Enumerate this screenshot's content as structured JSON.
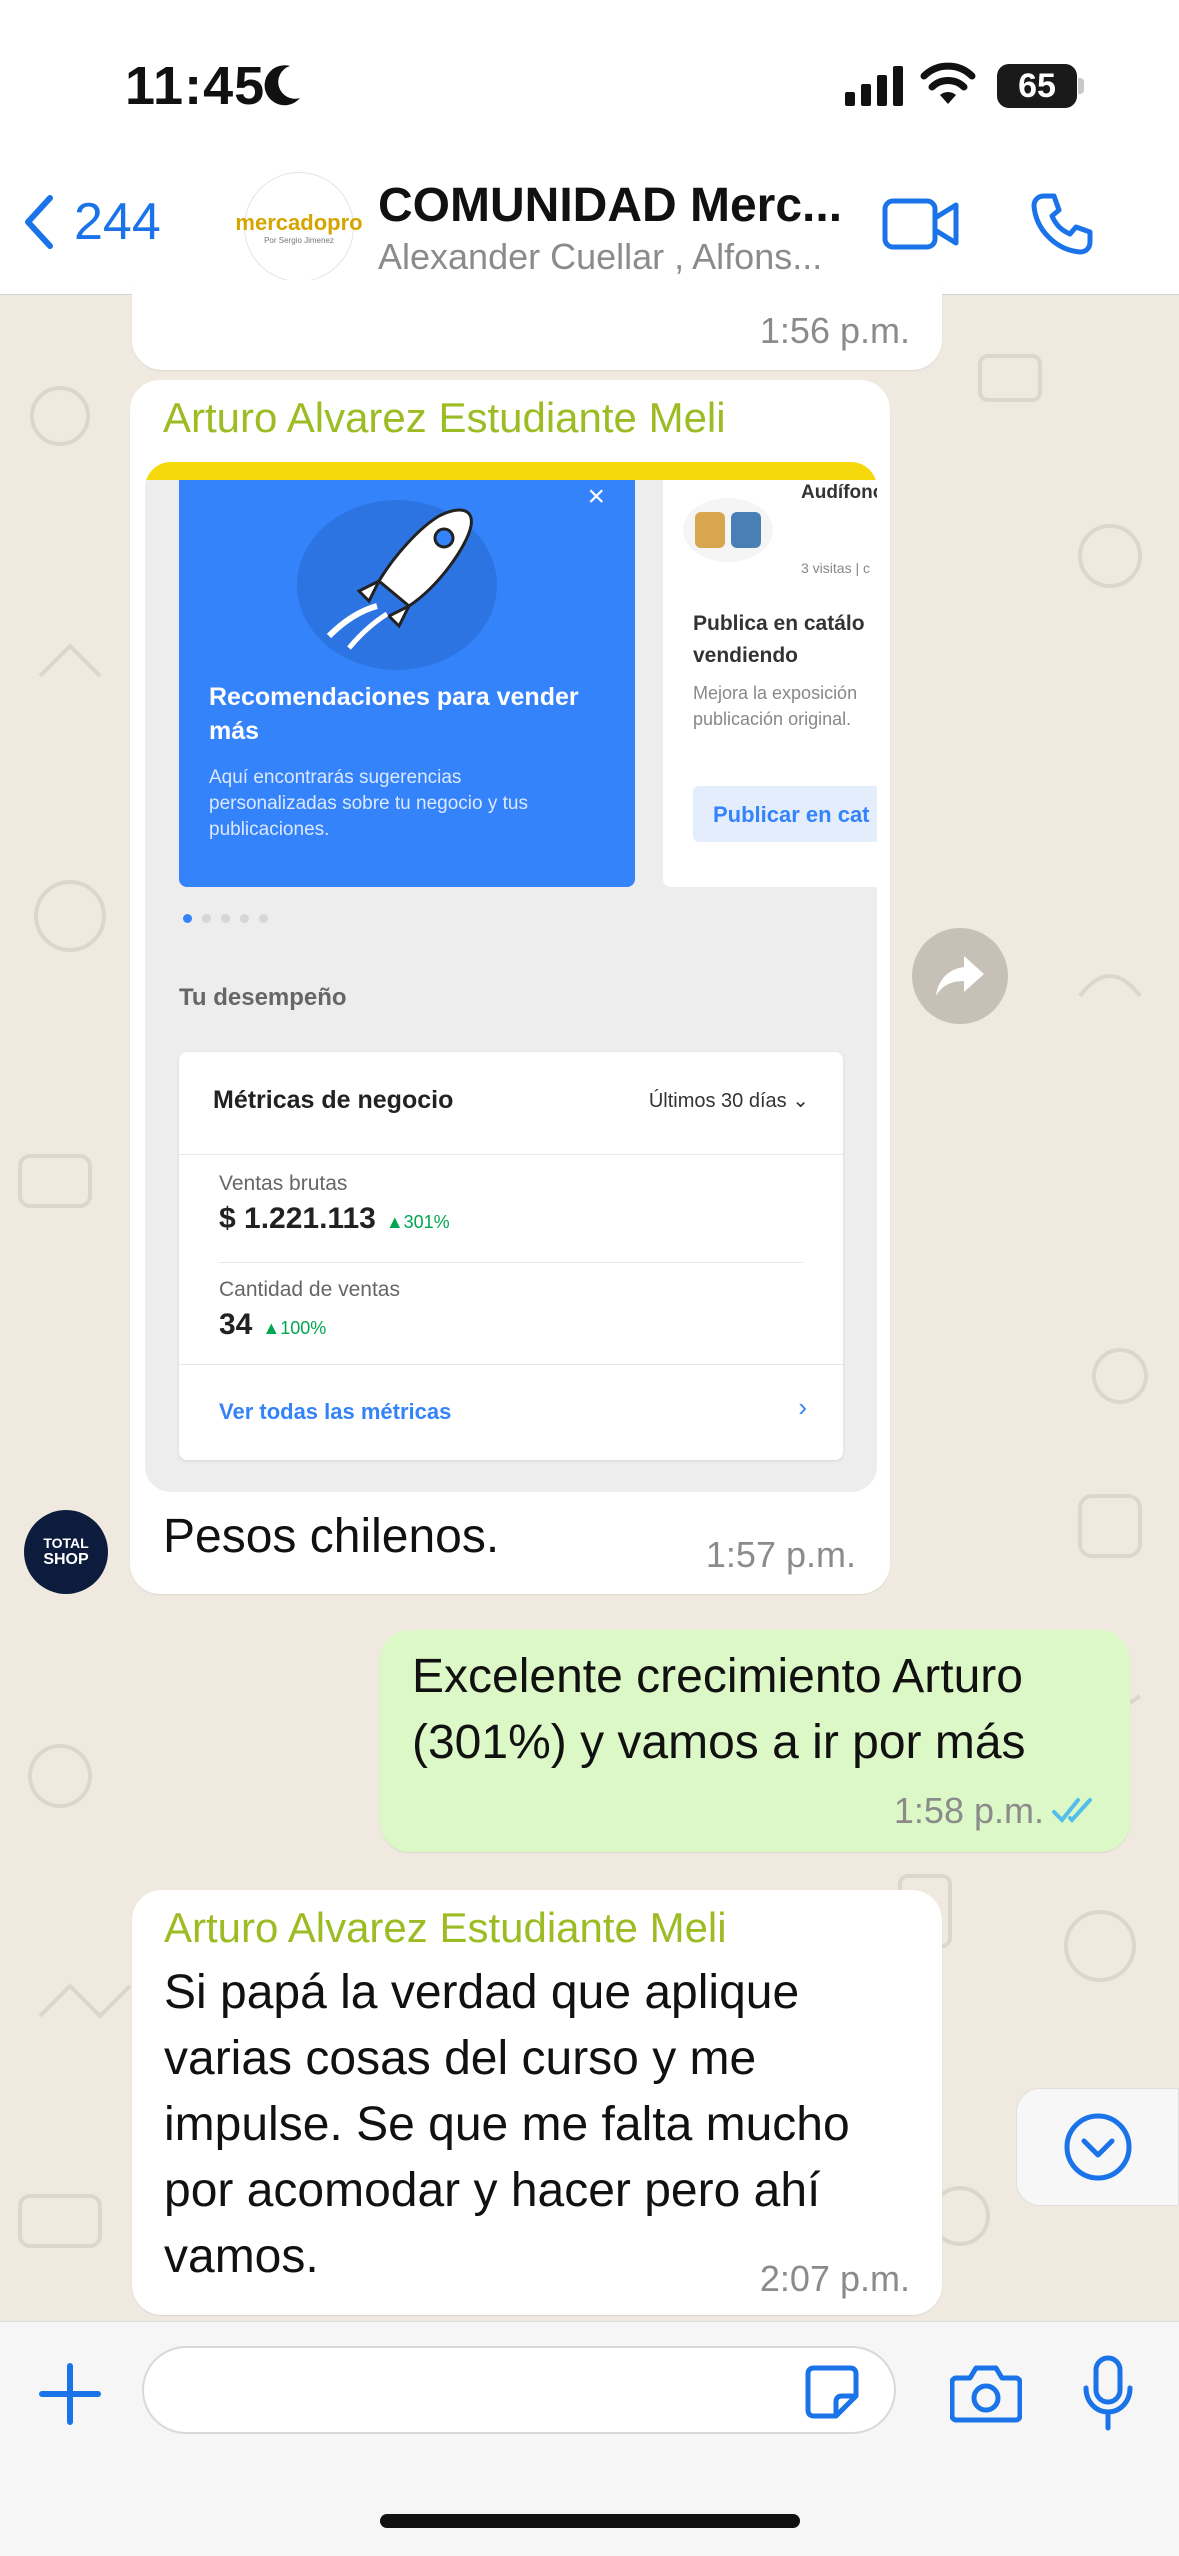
{
  "status_bar": {
    "time": "11:45",
    "battery": "65"
  },
  "header": {
    "back_count": "244",
    "avatar_logo": "mercadopro",
    "avatar_tagline": "Por Sergio Jimenez",
    "title": "COMUNIDAD Merc...",
    "subtitle": "Alexander Cuellar , Alfons..."
  },
  "messages": [
    {
      "type": "incoming_tail",
      "time": "1:56 p.m."
    },
    {
      "type": "incoming_image",
      "sender": "Arturo Alvarez  Estudiante Meli",
      "caption": "Pesos chilenos.",
      "time": "1:57 p.m.",
      "screenshot": {
        "banner_title": "Recomendaciones para vender más",
        "banner_desc": "Aquí encontrarás sugerencias personalizadas sobre tu negocio y tus publicaciones.",
        "card_product": "Audífono Moxom",
        "card_visits": "3 visitas | c",
        "card_title": "Publica en catálo vendiendo",
        "card_desc": "Mejora la exposición publicación original.",
        "card_button": "Publicar en cat",
        "section_title": "Tu desempeño",
        "metrics_title": "Métricas de negocio",
        "metrics_range": "Últimos 30 días",
        "gross_label": "Ventas brutas",
        "gross_value": "$ 1.221.113",
        "gross_pct": "▲301%",
        "count_label": "Cantidad de ventas",
        "count_value": "34",
        "count_pct": "▲100%",
        "link": "Ver todas las métricas"
      }
    },
    {
      "type": "outgoing",
      "text": "Excelente crecimiento Arturo (301%) y vamos a ir por más",
      "time": "1:58 p.m."
    },
    {
      "type": "incoming",
      "sender": "Arturo Alvarez  Estudiante Meli",
      "text": "Si papá la verdad que aplique varias cosas del curso y me impulse. Se que me falta mucho por acomodar y hacer pero ahí vamos.",
      "time": "2:07 p.m."
    }
  ],
  "member_avatar": {
    "line1": "TOTAL",
    "line2": "SHOP"
  },
  "input": {
    "value": "",
    "placeholder": ""
  },
  "colors": {
    "accent_blue": "#1a73e8",
    "sender_green": "#9dbb23",
    "outgoing_bubble": "#dcf8c6",
    "meli_blue": "#3483fa",
    "meli_yellow": "#f5d90a"
  }
}
